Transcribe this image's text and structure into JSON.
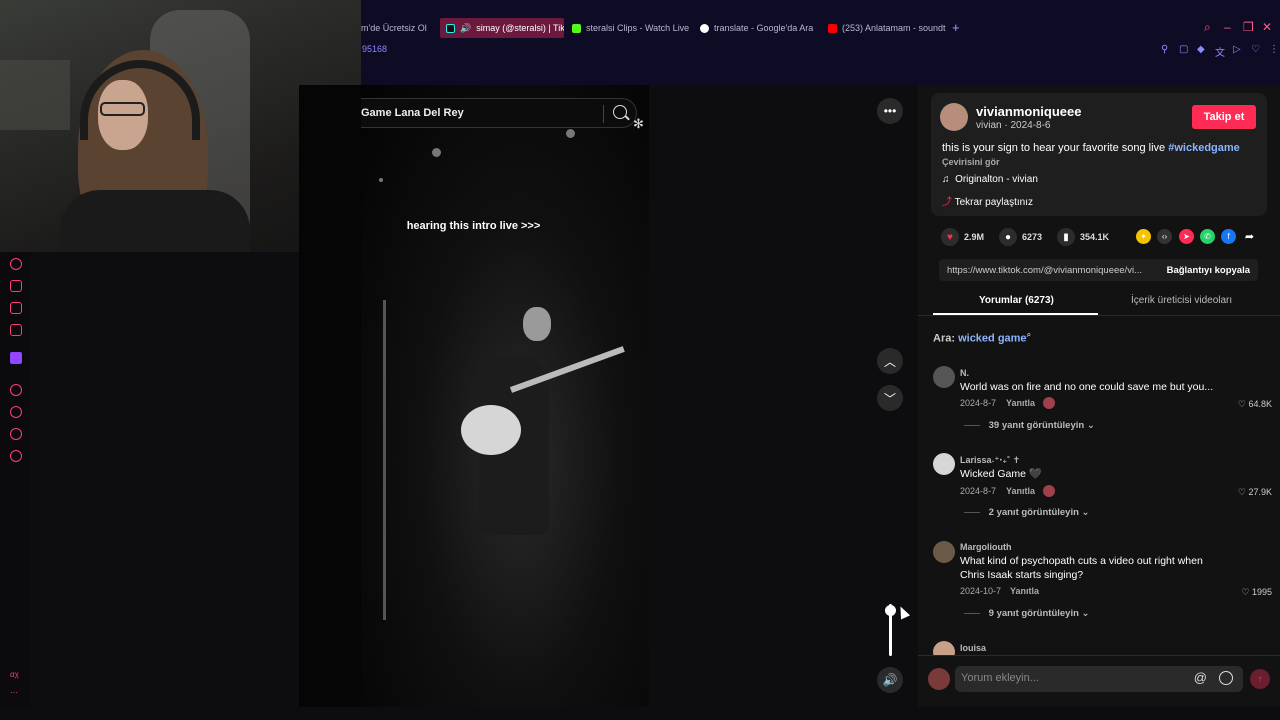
{
  "browser": {
    "tabs": [
      {
        "label": "m'de Ücretsiz Ol",
        "color": "#ff3e7a",
        "active": false
      },
      {
        "label": "simay (@steralsi) | Tik",
        "color": "#25f4ee",
        "active": true
      },
      {
        "label": "steralsi Clips - Watch Live",
        "color": "#53fc18",
        "active": false
      },
      {
        "label": "translate - Google'da Ara",
        "color": "#4285f4",
        "active": false
      },
      {
        "label": "(253) Anlatamam - soundt",
        "color": "#ff0000",
        "active": false
      }
    ],
    "url_fragment": "95168",
    "new_tab": "+"
  },
  "search": {
    "query": "Game Lana Del Rey"
  },
  "video": {
    "caption": "hearing this intro live >>>"
  },
  "post": {
    "username": "vivianmoniqueee",
    "display_name": "vivian",
    "date": "2024-8-6",
    "follow_label": "Takip et",
    "description": "this is your sign to hear your favorite song live",
    "hashtag": "#wickedgame",
    "translate_label": "Çevirisini gör",
    "music": "Originalton - vivian",
    "reposted": "Tekrar paylaştınız",
    "likes": "2.9M",
    "comments": "6273",
    "saves": "354.1K",
    "link": "https://www.tiktok.com/@vivianmoniqueee/vi...",
    "copy_link_label": "Bağlantıyı kopyala"
  },
  "tabs": {
    "comments": "Yorumlar (6273)",
    "creator_videos": "İçerik üreticisi videoları"
  },
  "related": {
    "prefix": "Ara:",
    "keyword": "wicked game"
  },
  "comments": [
    {
      "author": "N.",
      "text": "World was on fire and no one could save me but you...",
      "date": "2024-8-7",
      "reply": "Yanıtla",
      "likes": "64.8K",
      "view_replies": "39 yanıt görüntüleyin"
    },
    {
      "author": "Larissa˖⁺‧₊˚ ✝",
      "text": "Wicked Game 🖤",
      "date": "2024-8-7",
      "reply": "Yanıtla",
      "likes": "27.9K",
      "view_replies": "2 yanıt görüntüleyin"
    },
    {
      "author": "Margoliouth",
      "text": "What kind of psychopath cuts a video out right when Chris Isaak starts singing?",
      "date": "2024-10-7",
      "reply": "Yanıtla",
      "likes": "1995",
      "view_replies": "9 yanıt görüntüleyin"
    },
    {
      "author": "louisa"
    }
  ],
  "comment_input": {
    "placeholder": "Yorum ekleyin..."
  },
  "sidebar": {
    "bottom_label": "αχ"
  },
  "colors": {
    "accent": "#fe2c55",
    "link": "#8cb4ff",
    "sidebar_accent": "#ff3e7a"
  }
}
